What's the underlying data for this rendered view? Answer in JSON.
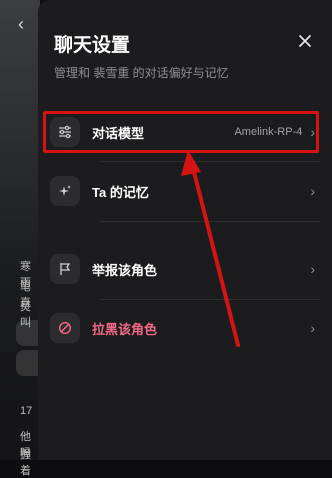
{
  "settings": {
    "title": "聊天设置",
    "subtitle": "管理和 裴雪重 的对话偏好与记忆",
    "items": [
      {
        "label": "对话模型",
        "value": "Amelink-RP-4"
      },
      {
        "label": "Ta 的记忆"
      },
      {
        "label": "举报该角色"
      },
      {
        "label": "拉黑该角色"
      }
    ]
  },
  "background": {
    "lines": [
      "寒雨",
      "笔直",
      "燹叫",
      "17",
      "他吗",
      "握着"
    ]
  },
  "colors": {
    "accent_red": "#d61313",
    "danger_pink": "#f06a8a",
    "sheet_bg": "#1c1c1e"
  }
}
